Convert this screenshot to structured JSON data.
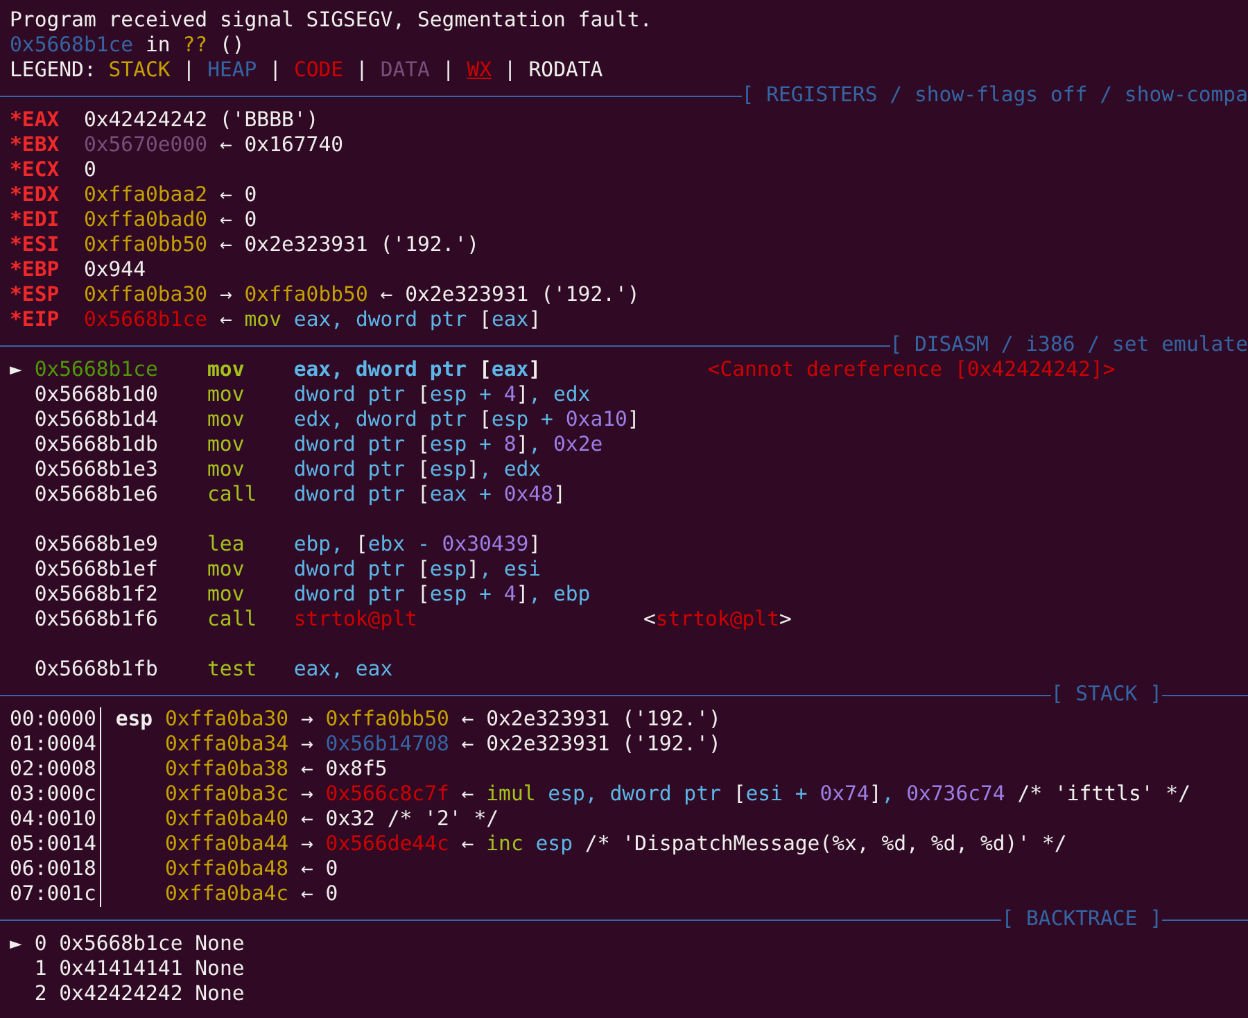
{
  "message_lines": [
    {
      "segments": [
        {
          "text": "Program received signal SIGSEGV, Segmentation fault.",
          "kind": "plain"
        }
      ]
    },
    {
      "segments": [
        {
          "text": "0x5668b1ce",
          "kind": "heap"
        },
        {
          "text": " in ",
          "kind": "plain"
        },
        {
          "text": "??",
          "kind": "stack"
        },
        {
          "text": " ()",
          "kind": "plain"
        }
      ]
    },
    {
      "segments": [
        {
          "text": "LEGEND: ",
          "kind": "plain"
        },
        {
          "text": "STACK",
          "kind": "stack"
        },
        {
          "text": " | ",
          "kind": "plain"
        },
        {
          "text": "HEAP",
          "kind": "heap"
        },
        {
          "text": " | ",
          "kind": "plain"
        },
        {
          "text": "CODE",
          "kind": "code"
        },
        {
          "text": " | ",
          "kind": "plain"
        },
        {
          "text": "DATA",
          "kind": "data"
        },
        {
          "text": " | ",
          "kind": "plain"
        },
        {
          "text": "WX",
          "kind": "wx"
        },
        {
          "text": " | ",
          "kind": "plain"
        },
        {
          "text": "RODATA",
          "kind": "plain"
        }
      ]
    }
  ],
  "registers": {
    "header": {
      "title": "[ REGISTERS / show-flags off / show-compa",
      "closed": false
    },
    "rows": [
      {
        "name": "*EAX",
        "segments": [
          {
            "text": "0x42424242 ('BBBB')",
            "kind": "plain"
          }
        ]
      },
      {
        "name": "*EBX",
        "segments": [
          {
            "text": "0x5670e000",
            "kind": "data"
          },
          {
            "text": " ← 0x167740",
            "kind": "plain"
          }
        ]
      },
      {
        "name": "*ECX",
        "segments": [
          {
            "text": "0",
            "kind": "plain"
          }
        ]
      },
      {
        "name": "*EDX",
        "segments": [
          {
            "text": "0xffa0baa2",
            "kind": "stack"
          },
          {
            "text": " ← 0",
            "kind": "plain"
          }
        ]
      },
      {
        "name": "*EDI",
        "segments": [
          {
            "text": "0xffa0bad0",
            "kind": "stack"
          },
          {
            "text": " ← 0",
            "kind": "plain"
          }
        ]
      },
      {
        "name": "*ESI",
        "segments": [
          {
            "text": "0xffa0bb50",
            "kind": "stack"
          },
          {
            "text": " ← 0x2e323931 ('192.')",
            "kind": "plain"
          }
        ]
      },
      {
        "name": "*EBP",
        "segments": [
          {
            "text": "0x944",
            "kind": "plain"
          }
        ]
      },
      {
        "name": "*ESP",
        "segments": [
          {
            "text": "0xffa0ba30",
            "kind": "stack"
          },
          {
            "text": " → ",
            "kind": "plain"
          },
          {
            "text": "0xffa0bb50",
            "kind": "stack"
          },
          {
            "text": " ← 0x2e323931 ('192.')",
            "kind": "plain"
          }
        ]
      },
      {
        "name": "*EIP",
        "segments": [
          {
            "text": "0x5668b1ce",
            "kind": "code"
          },
          {
            "text": " ← ",
            "kind": "plain"
          },
          {
            "text": "mov",
            "kind": "opcode"
          },
          {
            "text": " eax, dword ptr ",
            "kind": "operand"
          },
          {
            "text": "[",
            "kind": "plain"
          },
          {
            "text": "eax",
            "kind": "operand"
          },
          {
            "text": "]",
            "kind": "plain"
          }
        ]
      }
    ]
  },
  "disasm": {
    "header": {
      "title": "[ DISASM / i386 / set emulate",
      "closed": false
    },
    "marker": "►",
    "rows": [
      {
        "selected": true,
        "gap_before": false,
        "address": "0x5668b1ce",
        "mnemonic": "mov",
        "operands": [
          {
            "text": "eax, dword ptr ",
            "kind": "operand"
          },
          {
            "text": "[",
            "kind": "plain"
          },
          {
            "text": "eax",
            "kind": "operand"
          },
          {
            "text": "]",
            "kind": "plain"
          }
        ],
        "comment": [
          {
            "text": "<Cannot dereference [0x42424242]>",
            "kind": "symbol"
          }
        ]
      },
      {
        "selected": false,
        "gap_before": false,
        "address": "0x5668b1d0",
        "mnemonic": "mov",
        "operands": [
          {
            "text": "dword ptr ",
            "kind": "operand"
          },
          {
            "text": "[",
            "kind": "plain"
          },
          {
            "text": "esp + ",
            "kind": "operand"
          },
          {
            "text": "4",
            "kind": "number"
          },
          {
            "text": "]",
            "kind": "plain"
          },
          {
            "text": ", edx",
            "kind": "operand"
          }
        ]
      },
      {
        "selected": false,
        "gap_before": false,
        "address": "0x5668b1d4",
        "mnemonic": "mov",
        "operands": [
          {
            "text": "edx, dword ptr ",
            "kind": "operand"
          },
          {
            "text": "[",
            "kind": "plain"
          },
          {
            "text": "esp + ",
            "kind": "operand"
          },
          {
            "text": "0xa10",
            "kind": "number"
          },
          {
            "text": "]",
            "kind": "plain"
          }
        ]
      },
      {
        "selected": false,
        "gap_before": false,
        "address": "0x5668b1db",
        "mnemonic": "mov",
        "operands": [
          {
            "text": "dword ptr ",
            "kind": "operand"
          },
          {
            "text": "[",
            "kind": "plain"
          },
          {
            "text": "esp + ",
            "kind": "operand"
          },
          {
            "text": "8",
            "kind": "number"
          },
          {
            "text": "]",
            "kind": "plain"
          },
          {
            "text": ", ",
            "kind": "operand"
          },
          {
            "text": "0x2e",
            "kind": "number"
          }
        ]
      },
      {
        "selected": false,
        "gap_before": false,
        "address": "0x5668b1e3",
        "mnemonic": "mov",
        "operands": [
          {
            "text": "dword ptr ",
            "kind": "operand"
          },
          {
            "text": "[",
            "kind": "plain"
          },
          {
            "text": "esp",
            "kind": "operand"
          },
          {
            "text": "]",
            "kind": "plain"
          },
          {
            "text": ", edx",
            "kind": "operand"
          }
        ]
      },
      {
        "selected": false,
        "gap_before": false,
        "address": "0x5668b1e6",
        "mnemonic": "call",
        "operands": [
          {
            "text": "dword ptr ",
            "kind": "operand"
          },
          {
            "text": "[",
            "kind": "plain"
          },
          {
            "text": "eax + ",
            "kind": "operand"
          },
          {
            "text": "0x48",
            "kind": "number"
          },
          {
            "text": "]",
            "kind": "plain"
          }
        ]
      },
      {
        "selected": false,
        "gap_before": true,
        "address": "0x5668b1e9",
        "mnemonic": "lea",
        "operands": [
          {
            "text": "ebp, ",
            "kind": "operand"
          },
          {
            "text": "[",
            "kind": "plain"
          },
          {
            "text": "ebx - ",
            "kind": "operand"
          },
          {
            "text": "0x30439",
            "kind": "number"
          },
          {
            "text": "]",
            "kind": "plain"
          }
        ]
      },
      {
        "selected": false,
        "gap_before": false,
        "address": "0x5668b1ef",
        "mnemonic": "mov",
        "operands": [
          {
            "text": "dword ptr ",
            "kind": "operand"
          },
          {
            "text": "[",
            "kind": "plain"
          },
          {
            "text": "esp",
            "kind": "operand"
          },
          {
            "text": "]",
            "kind": "plain"
          },
          {
            "text": ", esi",
            "kind": "operand"
          }
        ]
      },
      {
        "selected": false,
        "gap_before": false,
        "address": "0x5668b1f2",
        "mnemonic": "mov",
        "operands": [
          {
            "text": "dword ptr ",
            "kind": "operand"
          },
          {
            "text": "[",
            "kind": "plain"
          },
          {
            "text": "esp + ",
            "kind": "operand"
          },
          {
            "text": "4",
            "kind": "number"
          },
          {
            "text": "]",
            "kind": "plain"
          },
          {
            "text": ", ebp",
            "kind": "operand"
          }
        ]
      },
      {
        "selected": false,
        "gap_before": false,
        "address": "0x5668b1f6",
        "mnemonic": "call",
        "operands": [
          {
            "text": "strtok@plt",
            "kind": "symbol"
          }
        ],
        "comment": [
          {
            "text": "<",
            "kind": "plain"
          },
          {
            "text": "strtok@plt",
            "kind": "symbol"
          },
          {
            "text": ">",
            "kind": "plain"
          }
        ]
      },
      {
        "selected": false,
        "gap_before": true,
        "address": "0x5668b1fb",
        "mnemonic": "test",
        "operands": [
          {
            "text": "eax, eax",
            "kind": "operand"
          }
        ]
      }
    ]
  },
  "stack": {
    "header": {
      "title": "[ STACK ]",
      "closed": true
    },
    "rows": [
      {
        "offset": "00:0000",
        "register": "esp",
        "segments": [
          {
            "text": "0xffa0ba30",
            "kind": "stack"
          },
          {
            "text": " → ",
            "kind": "plain"
          },
          {
            "text": "0xffa0bb50",
            "kind": "stack"
          },
          {
            "text": " ← 0x2e323931 ('192.')",
            "kind": "plain"
          }
        ]
      },
      {
        "offset": "01:0004",
        "segments": [
          {
            "text": "0xffa0ba34",
            "kind": "stack"
          },
          {
            "text": " → ",
            "kind": "plain"
          },
          {
            "text": "0x56b14708",
            "kind": "heap"
          },
          {
            "text": " ← 0x2e323931 ('192.')",
            "kind": "plain"
          }
        ]
      },
      {
        "offset": "02:0008",
        "segments": [
          {
            "text": "0xffa0ba38",
            "kind": "stack"
          },
          {
            "text": " ← 0x8f5",
            "kind": "plain"
          }
        ]
      },
      {
        "offset": "03:000c",
        "segments": [
          {
            "text": "0xffa0ba3c",
            "kind": "stack"
          },
          {
            "text": " → ",
            "kind": "plain"
          },
          {
            "text": "0x566c8c7f",
            "kind": "code"
          },
          {
            "text": " ← ",
            "kind": "plain"
          },
          {
            "text": "imul",
            "kind": "opcode"
          },
          {
            "text": " esp, dword ptr ",
            "kind": "operand"
          },
          {
            "text": "[",
            "kind": "plain"
          },
          {
            "text": "esi + ",
            "kind": "operand"
          },
          {
            "text": "0x74",
            "kind": "number"
          },
          {
            "text": "]",
            "kind": "plain"
          },
          {
            "text": ", ",
            "kind": "operand"
          },
          {
            "text": "0x736c74",
            "kind": "number"
          },
          {
            "text": " /* 'ifttls' */",
            "kind": "plain"
          }
        ]
      },
      {
        "offset": "04:0010",
        "segments": [
          {
            "text": "0xffa0ba40",
            "kind": "stack"
          },
          {
            "text": " ← 0x32 /* '2' */",
            "kind": "plain"
          }
        ]
      },
      {
        "offset": "05:0014",
        "segments": [
          {
            "text": "0xffa0ba44",
            "kind": "stack"
          },
          {
            "text": " → ",
            "kind": "plain"
          },
          {
            "text": "0x566de44c",
            "kind": "code"
          },
          {
            "text": " ← ",
            "kind": "plain"
          },
          {
            "text": "inc",
            "kind": "opcode"
          },
          {
            "text": " esp",
            "kind": "operand"
          },
          {
            "text": " /* 'DispatchMessage(%x, %d, %d, %d)' */",
            "kind": "plain"
          }
        ]
      },
      {
        "offset": "06:0018",
        "segments": [
          {
            "text": "0xffa0ba48",
            "kind": "stack"
          },
          {
            "text": " ← 0",
            "kind": "plain"
          }
        ]
      },
      {
        "offset": "07:001c",
        "segments": [
          {
            "text": "0xffa0ba4c",
            "kind": "stack"
          },
          {
            "text": " ← 0",
            "kind": "plain"
          }
        ]
      }
    ]
  },
  "backtrace": {
    "header": {
      "title": "[ BACKTRACE ]",
      "closed": true
    },
    "marker": "►",
    "rows": [
      {
        "selected": true,
        "index": "0",
        "address": "0x5668b1ce",
        "symbol": "None"
      },
      {
        "selected": false,
        "index": "1",
        "address": "0x41414141",
        "symbol": "None"
      },
      {
        "selected": false,
        "index": "2",
        "address": "0x42424242",
        "symbol": "None"
      }
    ]
  }
}
